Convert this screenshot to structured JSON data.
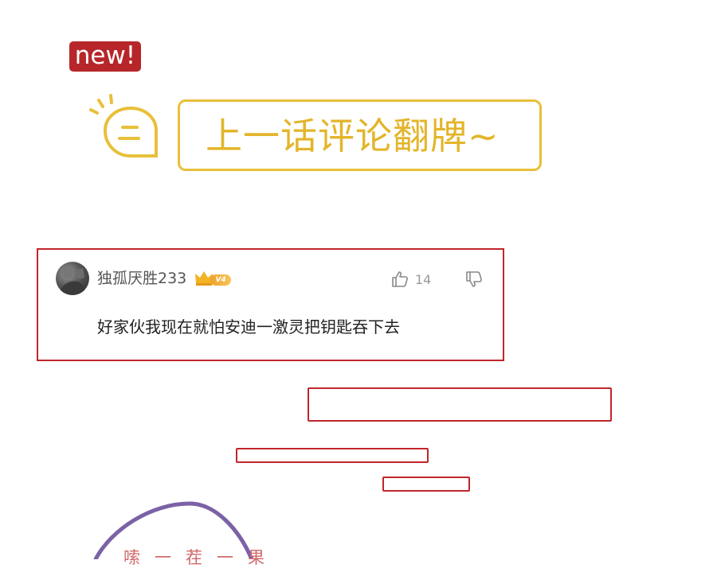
{
  "badge": {
    "label": "new!"
  },
  "header": {
    "title": "上一话评论翻牌~"
  },
  "comment": {
    "username": "独孤厌胜233",
    "vip_level": "V4",
    "likes": "14",
    "text": "好家伙我现在就怕安迪一激灵把钥匙吞下去"
  },
  "footer": {
    "partial_text": "嗦一茬一果"
  },
  "colors": {
    "badge_red": "#b7262a",
    "title_yellow": "#e3b52a",
    "frame_red": "#c0262b",
    "bubble_purple": "#7b62a6"
  }
}
